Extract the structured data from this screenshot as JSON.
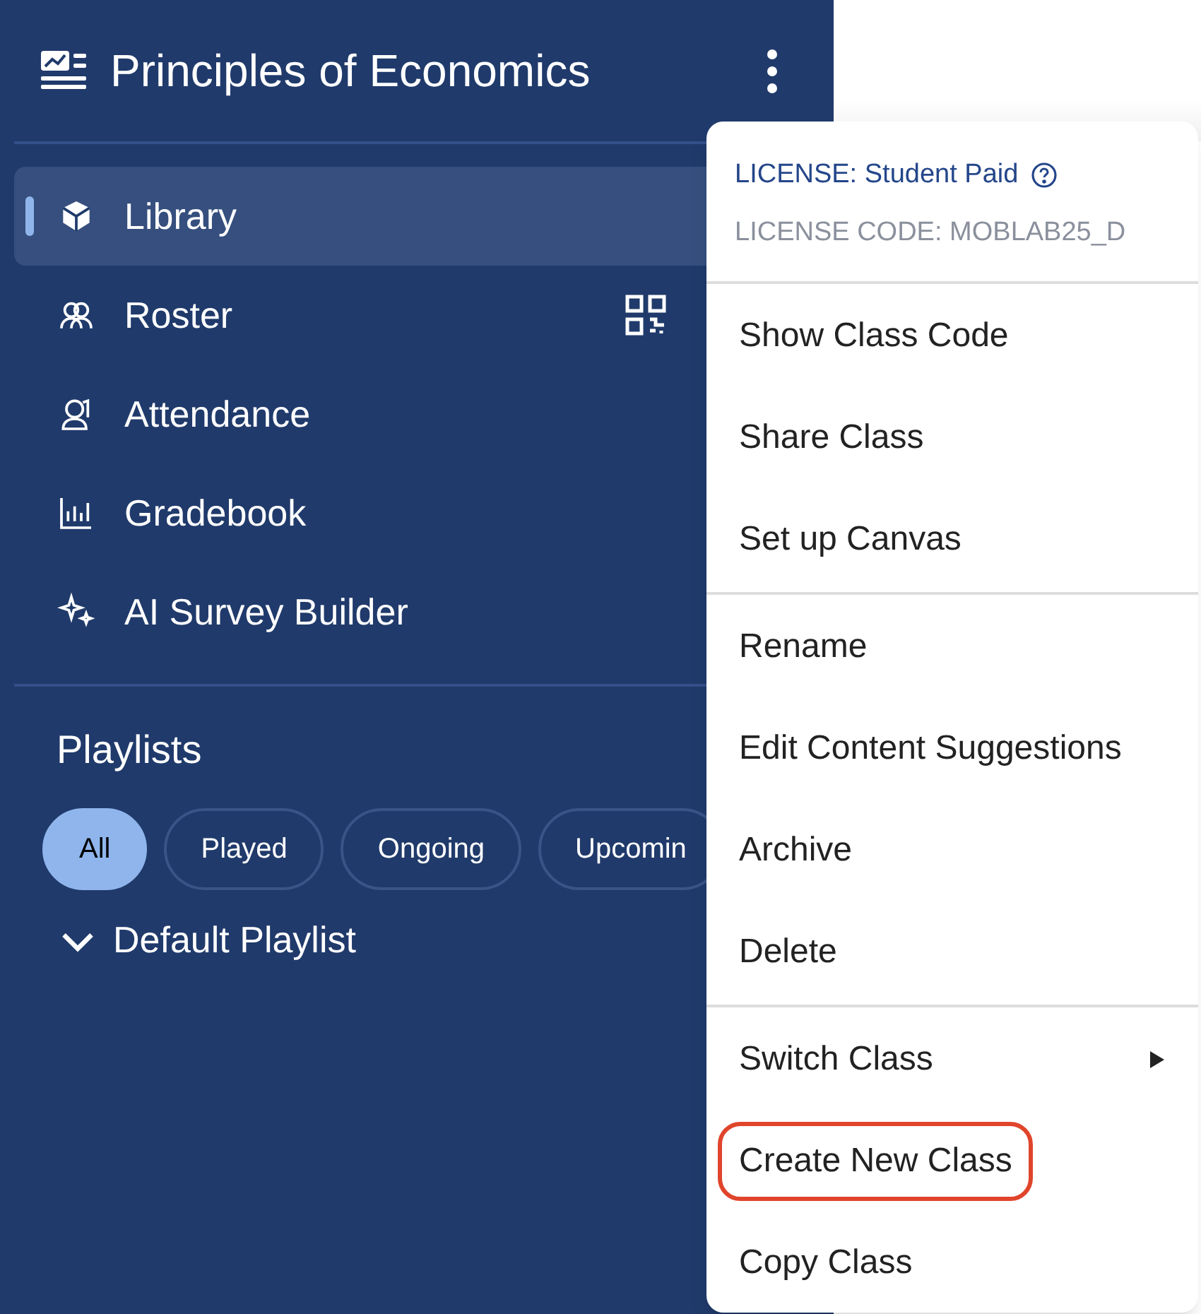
{
  "sidebar": {
    "title": "Principles of Economics",
    "nav": [
      {
        "label": "Library",
        "selected": true,
        "has_qr_code": false
      },
      {
        "label": "Roster",
        "selected": false,
        "has_qr_code": true
      },
      {
        "label": "Attendance",
        "selected": false,
        "has_qr_code": false
      },
      {
        "label": "Gradebook",
        "selected": false,
        "has_qr_code": false
      },
      {
        "label": "AI Survey Builder",
        "selected": false,
        "has_qr_code": false
      }
    ],
    "playlists_heading": "Playlists",
    "filters": [
      {
        "label": "All",
        "selected": true
      },
      {
        "label": "Played",
        "selected": false
      },
      {
        "label": "Ongoing",
        "selected": false
      },
      {
        "label": "Upcomin",
        "selected": false
      }
    ],
    "playlist": {
      "label": "Default Playlist",
      "expanded": true
    }
  },
  "menu": {
    "license": "LICENSE: Student Paid",
    "license_code": "LICENSE CODE: MOBLAB25_D",
    "groups": [
      [
        {
          "label": "Show Class Code",
          "kind": "item",
          "circled": false
        },
        {
          "label": "Share Class",
          "kind": "item",
          "circled": false
        },
        {
          "label": "Set up Canvas",
          "kind": "item",
          "circled": false
        }
      ],
      [
        {
          "label": "Rename",
          "kind": "item",
          "circled": false
        },
        {
          "label": "Edit Content Suggestions",
          "kind": "item",
          "circled": false
        },
        {
          "label": "Archive",
          "kind": "item",
          "circled": false
        },
        {
          "label": "Delete",
          "kind": "item",
          "circled": false
        }
      ],
      [
        {
          "label": "Switch Class",
          "kind": "submenu",
          "circled": false
        },
        {
          "label": "Create New Class",
          "kind": "item",
          "circled": true
        },
        {
          "label": "Copy Class",
          "kind": "item",
          "circled": false
        }
      ]
    ]
  }
}
